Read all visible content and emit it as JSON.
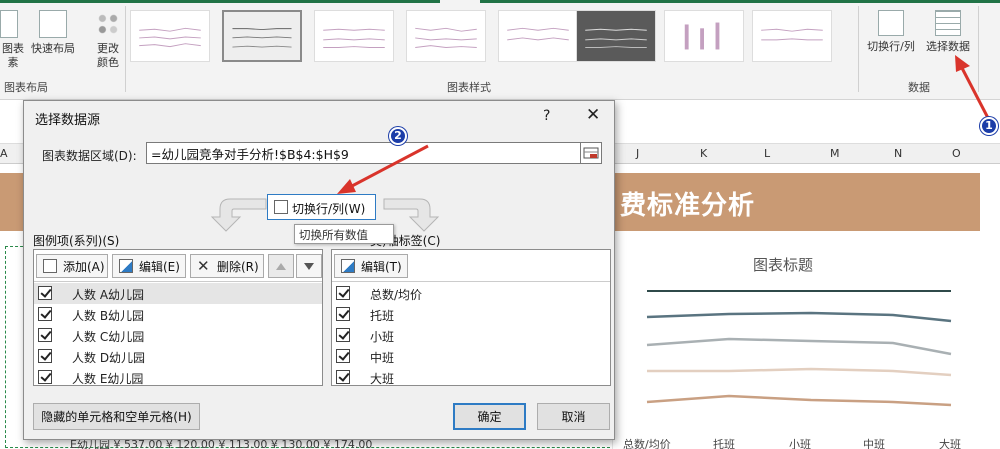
{
  "ribbon": {
    "buttons": {
      "add_chart_element": "图表\n素",
      "quick_layout": "快速布局",
      "change_colors": "更改\n颜色",
      "switch_row_col": "切换行/列",
      "select_data": "选择数据"
    },
    "groups": {
      "chart_layout": "图表布局",
      "chart_styles": "图表样式",
      "data": "数据"
    }
  },
  "sheet": {
    "column_headers": [
      "A",
      "J",
      "K",
      "L",
      "M",
      "N",
      "O"
    ],
    "banner_text": "费标准分析",
    "chart_title": "图表标题",
    "chart_categories": [
      "总数/均价",
      "托班",
      "小班",
      "中班",
      "大班"
    ],
    "bottom_row_text": "E幼儿园 ¥ 537.00 ¥ 120.00 ¥ 113.00 ¥ 130.00 ¥ 174.00"
  },
  "dialog": {
    "title": "选择数据源",
    "help": "?",
    "close": "✕",
    "range_label": "图表数据区域(D):",
    "range_value": "=幼儿园竞争对手分析!$B$4:$H$9",
    "switch_button": "切换行/列(W)",
    "tooltip": "切换所有数值",
    "legend": {
      "heading": "图例项(系列)(S)",
      "add": "添加(A)",
      "edit": "编辑(E)",
      "delete": "删除(R)",
      "items": [
        "人数 A幼儿园",
        "人数 B幼儿园",
        "人数 C幼儿园",
        "人数 D幼儿园",
        "人数 E幼儿园"
      ]
    },
    "axis": {
      "heading": "类)轴标签(C)",
      "edit": "编辑(T)",
      "items": [
        "总数/均价",
        "托班",
        "小班",
        "中班",
        "大班"
      ]
    },
    "hidden_cells_button": "隐藏的单元格和空单元格(H)",
    "ok": "确定",
    "cancel": "取消"
  },
  "annotations": {
    "badge1": "1",
    "badge2": "2"
  },
  "colors": {
    "accent": "#2e7bc4",
    "banner": "#c99a74",
    "arrow": "#d9342b",
    "badge": "#1c3da8"
  }
}
